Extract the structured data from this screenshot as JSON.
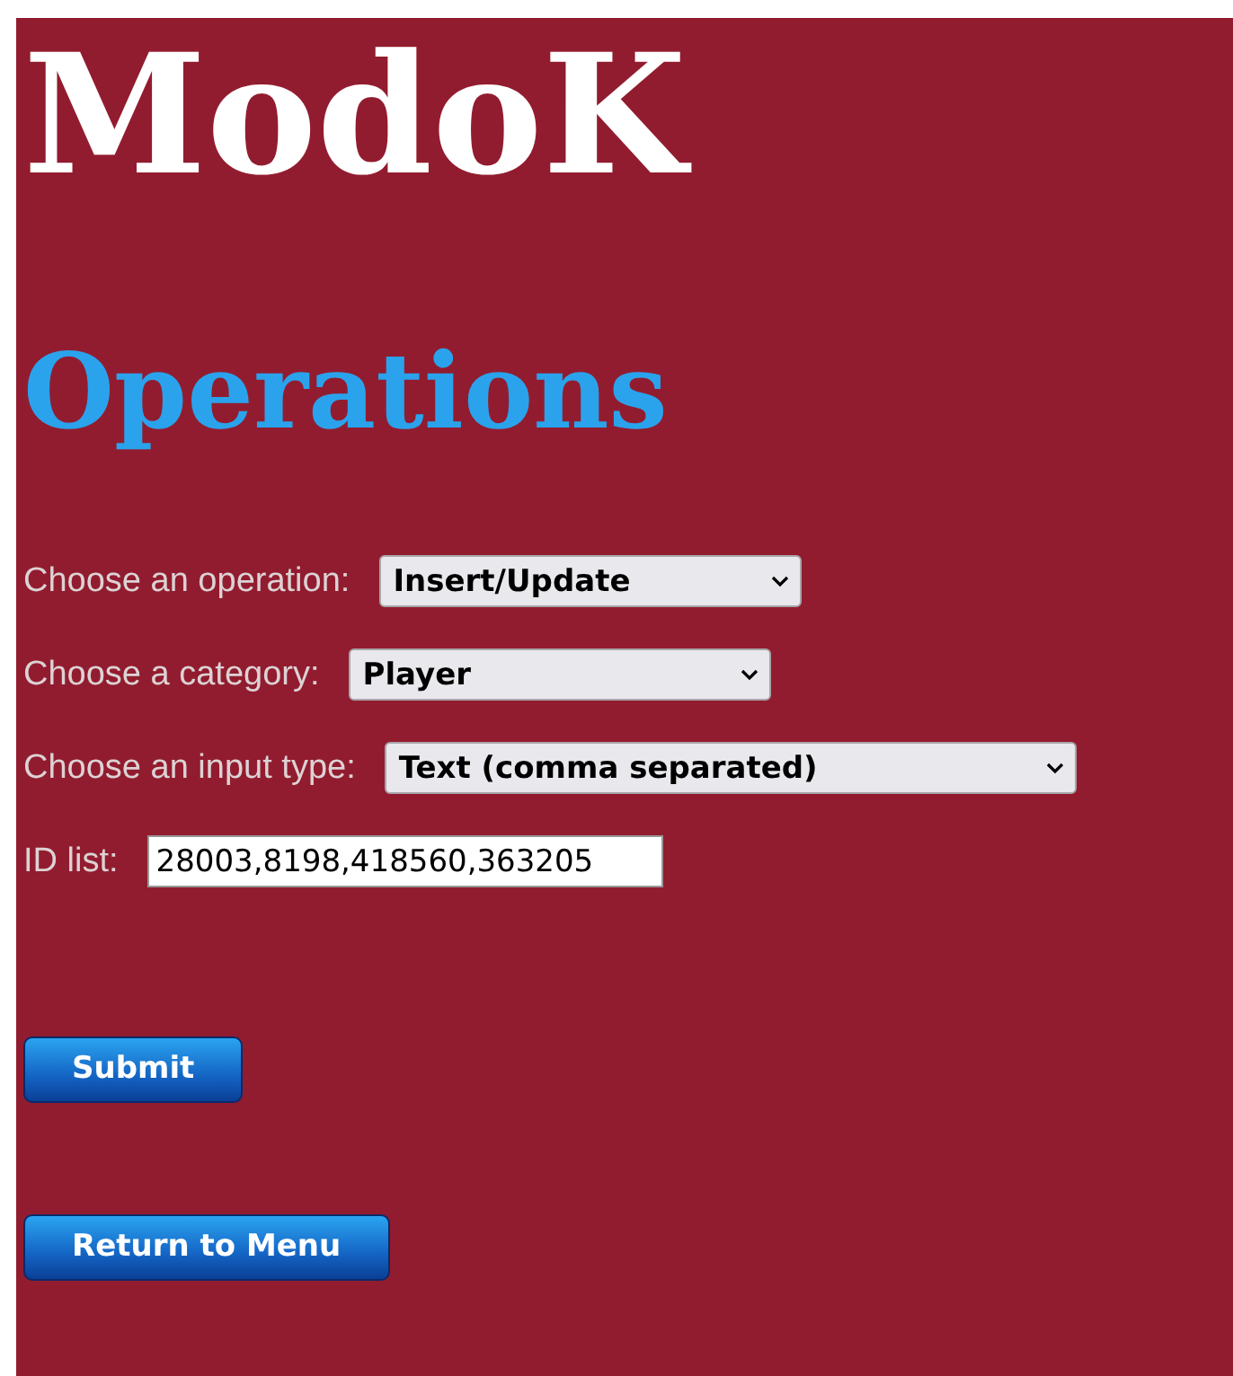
{
  "title": "ModoK",
  "heading": "Operations",
  "fields": [
    {
      "kind": "select",
      "label": "Choose an operation:",
      "value": "Insert/Update"
    },
    {
      "kind": "select",
      "label": "Choose a category:",
      "value": "Player"
    },
    {
      "kind": "select",
      "label": "Choose an input type:",
      "value": "Text (comma separated)"
    },
    {
      "kind": "text",
      "label": "ID list:",
      "value": "28003,8198,418560,363205"
    }
  ],
  "buttons": [
    {
      "label": "Submit"
    },
    {
      "label": "Return to Menu"
    }
  ]
}
